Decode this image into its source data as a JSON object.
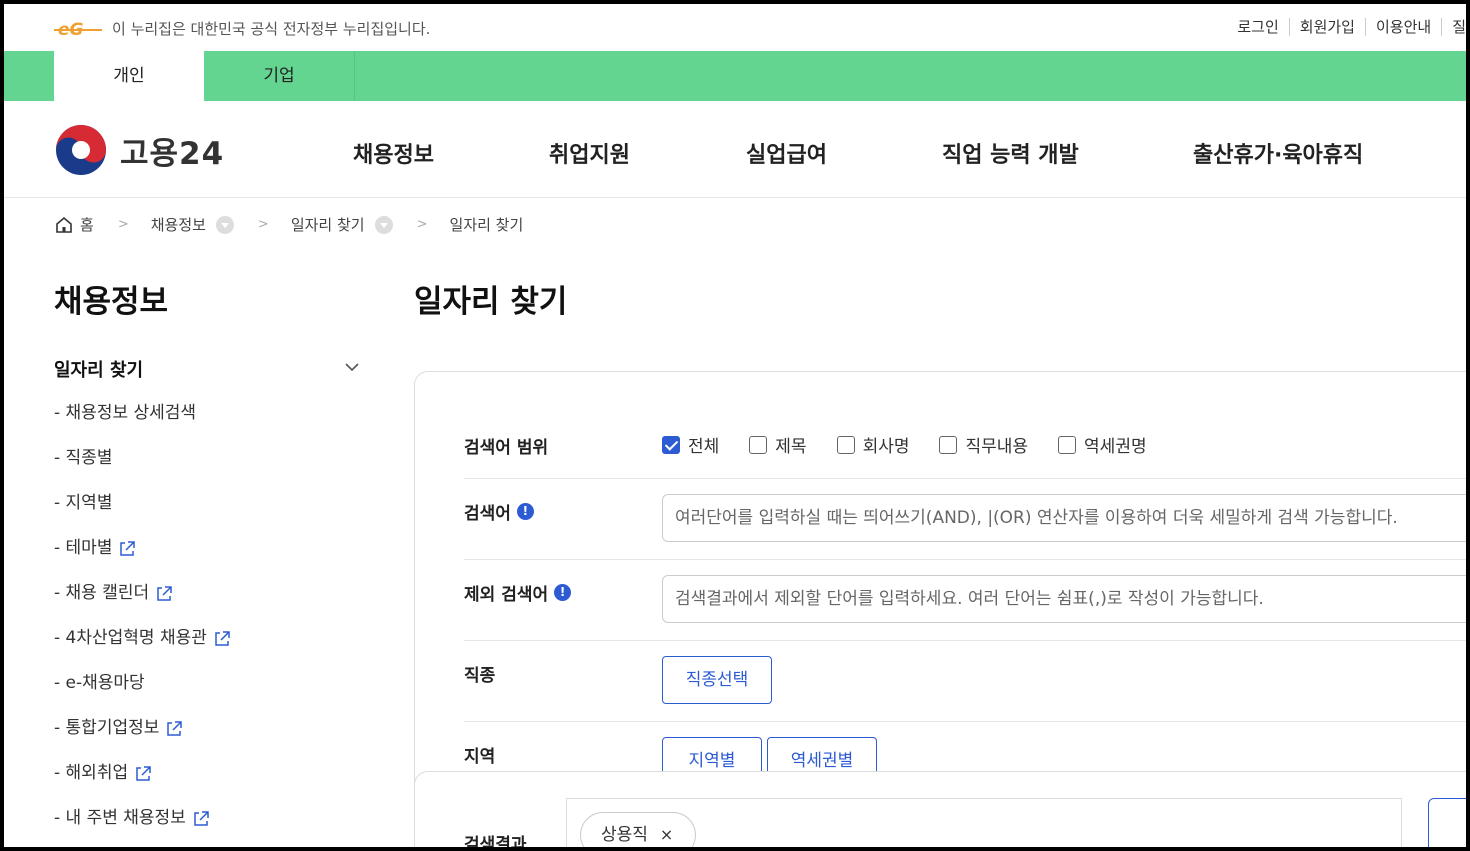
{
  "gov_bar": {
    "logo_text": "eG",
    "notice": "이 누리집은 대한민국 공식 전자정부 누리집입니다.",
    "links": [
      "로그인",
      "회원가입",
      "이용안내",
      "질"
    ]
  },
  "audience_tabs": [
    {
      "label": "개인",
      "active": true
    },
    {
      "label": "기업",
      "active": false
    }
  ],
  "header": {
    "logo_text": "고용24",
    "menu": [
      "채용정보",
      "취업지원",
      "실업급여",
      "직업 능력 개발",
      "출산휴가·육아휴직"
    ]
  },
  "breadcrumb": {
    "home": "홈",
    "level1": "채용정보",
    "level2": "일자리 찾기",
    "current": "일자리 찾기"
  },
  "sidebar": {
    "title": "채용정보",
    "section": "일자리 찾기",
    "items": [
      {
        "label": "- 채용정보 상세검색",
        "external": false
      },
      {
        "label": "- 직종별",
        "external": false
      },
      {
        "label": "- 지역별",
        "external": false
      },
      {
        "label": "- 테마별",
        "external": true
      },
      {
        "label": "- 채용 캘린더",
        "external": true
      },
      {
        "label": "- 4차산업혁명 채용관",
        "external": true
      },
      {
        "label": "- e-채용마당",
        "external": false
      },
      {
        "label": "- 통합기업정보",
        "external": true
      },
      {
        "label": "- 해외취업",
        "external": true
      },
      {
        "label": "- 내 주변 채용정보",
        "external": true
      }
    ]
  },
  "main": {
    "title": "일자리 찾기",
    "search_scope": {
      "label": "검색어 범위",
      "options": [
        {
          "label": "전체",
          "checked": true
        },
        {
          "label": "제목",
          "checked": false
        },
        {
          "label": "회사명",
          "checked": false
        },
        {
          "label": "직무내용",
          "checked": false
        },
        {
          "label": "역세권명",
          "checked": false
        }
      ]
    },
    "keyword": {
      "label": "검색어",
      "placeholder": "여러단어를 입력하실 때는 띄어쓰기(AND), |(OR) 연산자를 이용하여 더욱 세밀하게 검색 가능합니다."
    },
    "exclude": {
      "label": "제외 검색어",
      "placeholder": "검색결과에서 제외할 단어를 입력하세요. 여러 단어는 쉼표(,)로 작성이 가능합니다."
    },
    "job_type": {
      "label": "직종",
      "button": "직종선택"
    },
    "region": {
      "label": "지역",
      "buttons": [
        "지역별",
        "역세권별"
      ]
    },
    "result": {
      "label": "검색결과",
      "chip": "상용직",
      "chip_remove": "×"
    }
  },
  "colors": {
    "green": "#63d591",
    "accent": "#2d5bd3"
  }
}
